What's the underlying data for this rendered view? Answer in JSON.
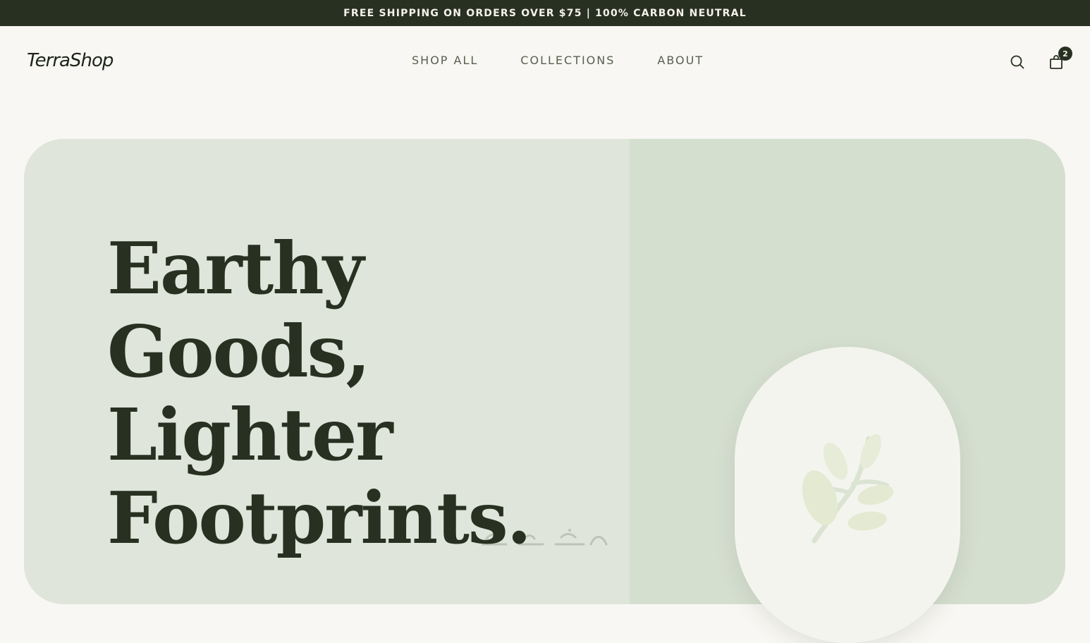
{
  "announcement": "FREE SHIPPING ON ORDERS OVER $75 | 100% CARBON NEUTRAL",
  "header": {
    "logo": "TerraShop",
    "nav": [
      "SHOP ALL",
      "COLLECTIONS",
      "ABOUT"
    ],
    "icons": {
      "search": "search-icon",
      "cart": "shopping-bag-icon"
    },
    "cart_count": "2"
  },
  "hero": {
    "headline": [
      "Earthy",
      "Goods,",
      "Lighter",
      "Footprints."
    ],
    "illustration_icon": "leaf-branch-icon"
  },
  "colors": {
    "dark": "#283021",
    "page_bg": "#f8f7f3",
    "hero_left": "#dfe5da",
    "hero_right": "#d5dfd0",
    "card": "#f4f4ef",
    "leaf": "#e3ead1",
    "nav_text": "#59604e"
  }
}
